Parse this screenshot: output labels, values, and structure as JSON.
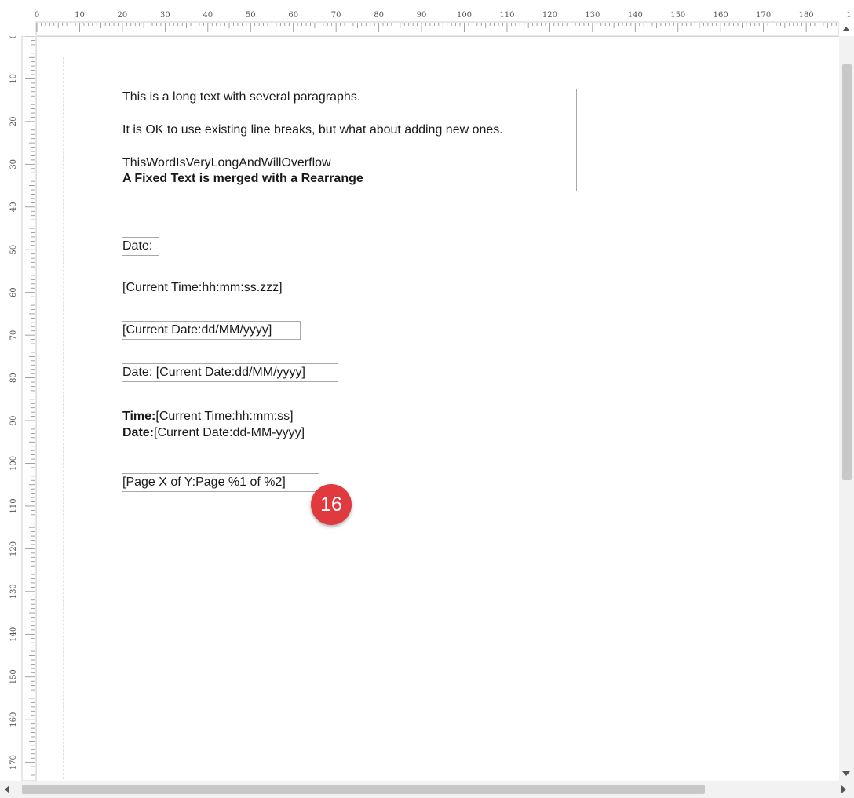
{
  "ruler": {
    "top_labels": [
      "0",
      "10",
      "20",
      "30",
      "40",
      "50",
      "60",
      "70",
      "80",
      "90",
      "100",
      "110",
      "120",
      "130",
      "140",
      "150",
      "160",
      "170",
      "180",
      "1"
    ],
    "left_labels": [
      "0",
      "10",
      "20",
      "30",
      "40",
      "50",
      "60",
      "70",
      "80",
      "90",
      "100",
      "110",
      "120",
      "130",
      "140",
      "150",
      "160",
      "170"
    ]
  },
  "report": {
    "long_text": {
      "p1": "This is a long text with several paragraphs.",
      "p2": "It is OK to use existing line breaks, but what about adding new ones.",
      "p3": "ThisWordIsVeryLongAndWillOverflow",
      "p4": "A Fixed Text is merged with a Rearrange"
    },
    "date_label": "Date:",
    "current_time": "[Current Time:hh:mm:ss.zzz]",
    "current_date": "[Current Date:dd/MM/yyyy]",
    "date_with_current": "Date: [Current Date:dd/MM/yyyy]",
    "time_label": "Time:",
    "time_value": "[Current Time:hh:mm:ss]",
    "date_label2": "Date:",
    "date_value2": "[Current Date:dd-MM-yyyy]",
    "page_x_of_y": "[Page X of Y:Page %1 of %2]"
  },
  "badge": {
    "number": "16",
    "color": "#e0393e"
  }
}
